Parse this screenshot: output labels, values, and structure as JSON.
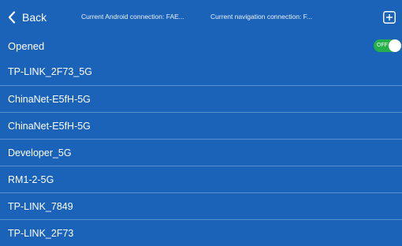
{
  "header": {
    "back_label": "Back",
    "android_connection": "Current Android connection: FAE...",
    "navigation_connection": "Current navigation connection: F..."
  },
  "wifi_toggle": {
    "label": "Opened",
    "state_text": "OFF"
  },
  "networks": [
    "TP-LINK_2F73_5G",
    "ChinaNet-E5fH-5G",
    "ChinaNet-E5fH-5G",
    "Developer_5G",
    "RM1-2-5G",
    "TP-LINK_7849",
    "TP-LINK_2F73"
  ],
  "colors": {
    "background": "#1a63b8",
    "divider": "#5b8fd0",
    "toggle_accent": "#25b04a"
  },
  "icons": {
    "back": "chevron-left-icon",
    "add": "plus-square-icon"
  }
}
